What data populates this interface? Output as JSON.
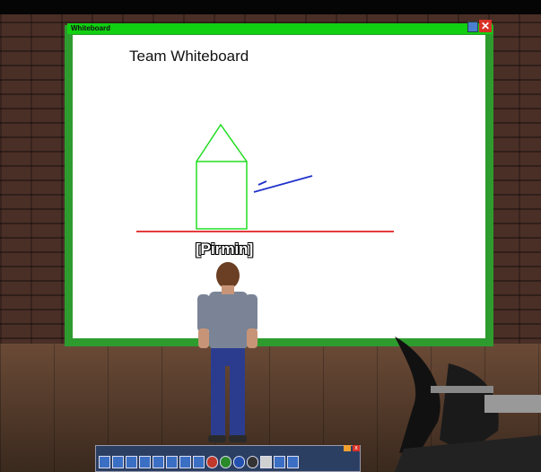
{
  "window": {
    "title": "Whiteboard",
    "close_glyph": "✕",
    "heading": "Team Whiteboard"
  },
  "avatar": {
    "name_tag": "[Pirmin]"
  },
  "drawing": {
    "colors": {
      "house": "#22dd22",
      "arrow": "#2233cc",
      "ground_line": "#e02020"
    }
  },
  "toolbar": {
    "tools": [
      "presentation-icon",
      "hand-icon",
      "select-icon",
      "line-icon",
      "rectangle-icon",
      "ellipse-icon",
      "text-icon",
      "image-icon",
      "color-red",
      "color-green",
      "color-blue",
      "color-black",
      "eraser-icon",
      "settings-icon",
      "copy-icon"
    ],
    "close_glyph": "x"
  },
  "colors": {
    "frame": "#2e9b2e",
    "titlebar": "#11d011",
    "toolbar": "#2b3f63"
  }
}
